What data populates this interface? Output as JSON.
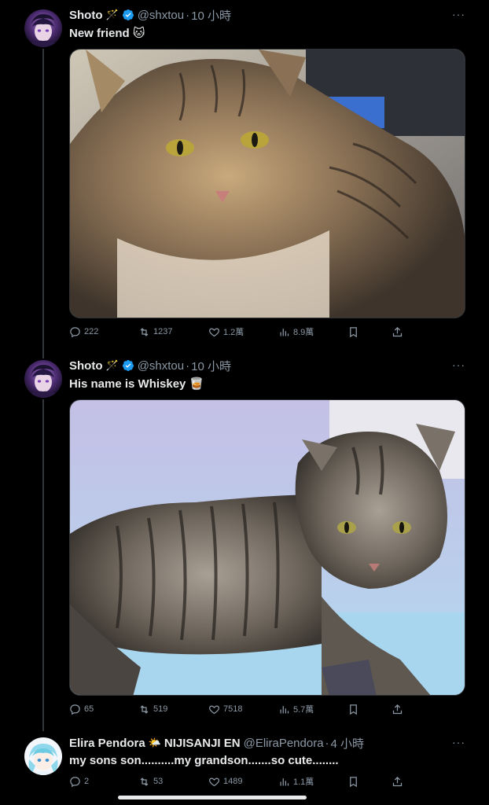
{
  "tweets": [
    {
      "name": "Shoto",
      "name_emoji": "🪄",
      "handle": "@shxtou",
      "time": "10 小時",
      "text": "New friend 🐱",
      "actions": {
        "replies": "222",
        "reposts": "1237",
        "likes": "1.2萬",
        "views": "8.9萬"
      }
    },
    {
      "name": "Shoto",
      "name_emoji": "🪄",
      "handle": "@shxtou",
      "time": "10 小時",
      "text": "His name is Whiskey 🥃",
      "actions": {
        "replies": "65",
        "reposts": "519",
        "likes": "7518",
        "views": "5.7萬"
      }
    },
    {
      "name": "Elira Pendora",
      "name_emoji": "🌤️",
      "org": "NIJISANJI EN",
      "handle": "@EliraPendora",
      "time": "4 小時",
      "text": "my sons son..........my grandson.......so cute........",
      "actions": {
        "replies": "2",
        "reposts": "53",
        "likes": "1489",
        "views": "1.1萬"
      }
    }
  ],
  "dot": "·",
  "more": "···",
  "colors": {
    "verified": "#1d9bf0",
    "muted": "#8b98a5",
    "text": "#e7e9ea",
    "bg": "#000000"
  }
}
